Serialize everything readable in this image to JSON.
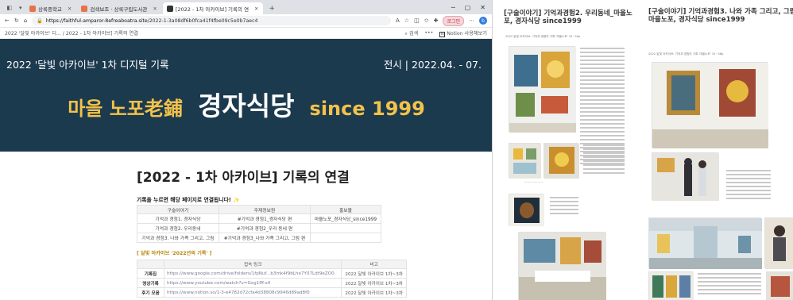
{
  "browser": {
    "tabs": [
      {
        "label": "상록중학교",
        "active": false,
        "color": "#e8734a"
      },
      {
        "label": "검색보조 · 상록구립도서관",
        "active": false,
        "color": "#e8734a"
      },
      {
        "label": "[2022 - 1차 아카이브] 기록의 연",
        "active": true,
        "color": "#333333"
      }
    ],
    "url_host": "https://faithful-amparor-8efreaboatra.site",
    "url_path": "/2022-1-3a08df6b0fca41f4fbe09c5e0b7aec4",
    "profile_label": "로그인",
    "notion_breadcrumb": "2022 '달빛 아카이브' 디... / 2022 - 1차 아카이브] 기록의 연결",
    "notion_search": "검색",
    "notion_more": "•••",
    "notion_open": "Notion 사용해보기"
  },
  "banner": {
    "left": "2022 '달빛 아카이브' 1차 디지털 기록",
    "right": "전시  |  2022.04. - 07.",
    "title_prefix": "마을 노포老鋪",
    "title_main": "경자식당",
    "title_since": "since 1999"
  },
  "page": {
    "heading": "[2022 - 1차 아카이브] 기록의 연결",
    "subnote": "기록을 누르면 해당 페이지로 연결됩니다!",
    "table1": {
      "headers": [
        "구술이야기",
        "주제정보원",
        "홍보물"
      ],
      "rows": [
        [
          "기억과 경험1. 경자식당",
          "#기억과 경험1_경자식당 편",
          "마을노포_경자식당_since1999"
        ],
        [
          "기억과 경험2. 우리동네",
          "#기억과 경험2_우리 동네 편",
          ""
        ],
        [
          "기억과 경험3. 나와 가족 그리고, 그림",
          "#기억과 경험3_나와 가족 그리고, 그림 편",
          ""
        ]
      ]
    },
    "section2": "[ 달빛 아카이브 '2022년의 기록' ]",
    "table2": {
      "headers": [
        "",
        "접속 링크",
        "비고"
      ],
      "rows": [
        {
          "k": "기록집",
          "link": "https://www.google.com/drive/folders/1fpNuf...b3mk4f9bLhe7Y07Ldt9eZO0",
          "note": "2022 달빛 아카이브 1차~3차"
        },
        {
          "k": "영상기록",
          "link": "https://www.youtube.com/watch?v=Gxg1fff-s4",
          "note": "2022 달빛 아카이브 1차~3차"
        },
        {
          "k": "후기 모음",
          "link": "https://www.notion.so/1-3-e4782d72cfa4d38808c9946d89ad8f0",
          "note": "2022 달빛 아카이브 1차~3차"
        }
      ]
    }
  },
  "doc1": {
    "title": "[구술이야기] 기억과경험2. 우리동네_마을노포, 경자식당 since1999",
    "sub": "2022 달빛 아카이브: 기억과 경험의 기록 '마을노포' 25~30p"
  },
  "doc2": {
    "title": "[구술이야기] 기억과경험3. 나와 가족 그리고, 그림_마을노포, 경자식당 since1999",
    "sub": "2022 달빛 아카이브: 기억과 경험의 기록 '마을노포' 31~36p"
  }
}
